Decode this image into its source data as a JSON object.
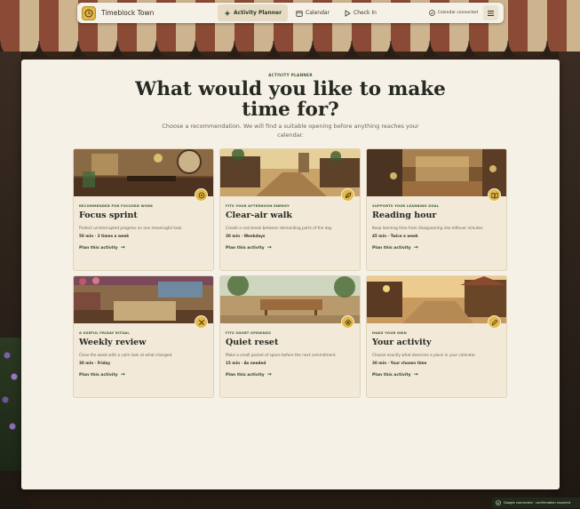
{
  "app": {
    "name": "Timeblock Town"
  },
  "nav": {
    "tabs": [
      {
        "label": "Activity Planner",
        "active": true,
        "icon": "sparkle-icon"
      },
      {
        "label": "Calendar",
        "active": false,
        "icon": "calendar-icon"
      },
      {
        "label": "Check In",
        "active": false,
        "icon": "play-icon"
      }
    ],
    "calendar_status": "Calendar connected",
    "menu_icon": "hamburger-menu-icon"
  },
  "page": {
    "eyebrow": "ACTIVITY PLANNER",
    "title": "What would you like to make time for?",
    "subtitle": "Choose a recommendation. We will find a suitable opening before anything reaches your calendar."
  },
  "cards": [
    {
      "tag": "RECOMMENDED FOR FOCUSED WORK",
      "title": "Focus sprint",
      "desc": "Protect uninterrupted progress on one meaningful task.",
      "meta": "50 min · 3 times a week",
      "link": "Plan this activity",
      "icon": "target-icon",
      "scene": "study-room"
    },
    {
      "tag": "FITS YOUR AFTERNOON ENERGY",
      "title": "Clear-air walk",
      "desc": "Create a real break between demanding parts of the day.",
      "meta": "30 min · Weekdays",
      "link": "Plan this activity",
      "icon": "leaf-icon",
      "scene": "village-street"
    },
    {
      "tag": "SUPPORTS YOUR LEARNING GOAL",
      "title": "Reading hour",
      "desc": "Keep learning time from disappearing into leftover minutes.",
      "meta": "45 min · Twice a week",
      "link": "Plan this activity",
      "icon": "book-icon",
      "scene": "reading-room"
    },
    {
      "tag": "A USEFUL FRIDAY RITUAL",
      "title": "Weekly review",
      "desc": "Close the week with a calm look at what changed.",
      "meta": "30 min · Friday",
      "link": "Plan this activity",
      "icon": "tools-icon",
      "scene": "planning-room"
    },
    {
      "tag": "FITS SHORT OPENINGS",
      "title": "Quiet reset",
      "desc": "Make a small pocket of space before the next commitment.",
      "meta": "15 min · As needed",
      "link": "Plan this activity",
      "icon": "flower-icon",
      "scene": "garden-terrace"
    },
    {
      "tag": "MAKE YOUR OWN",
      "title": "Your activity",
      "desc": "Choose exactly what deserves a place in your calendar.",
      "meta": "30 min · Your chosen time",
      "link": "Plan this activity",
      "icon": "pencil-icon",
      "scene": "sunset-village"
    }
  ],
  "toast": {
    "text": "Google connected · confirmation required",
    "icon": "check-circle-icon"
  }
}
